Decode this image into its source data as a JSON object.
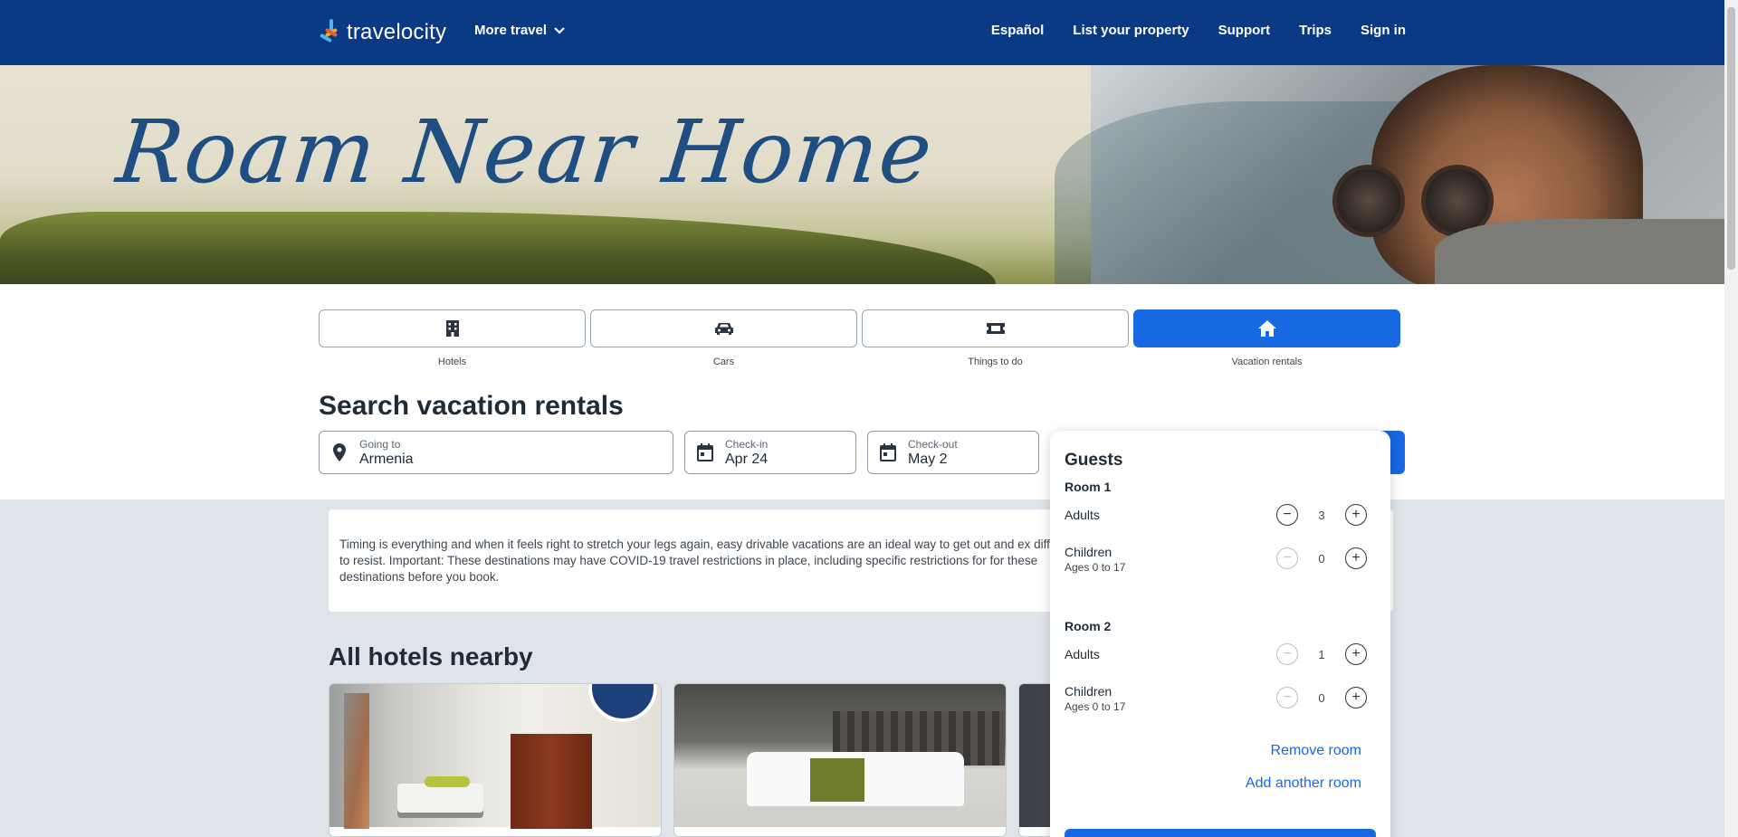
{
  "header": {
    "logo_text": "travelocity",
    "more_travel": "More travel",
    "nav": [
      "Español",
      "List your property",
      "Support",
      "Trips",
      "Sign in"
    ]
  },
  "hero": {
    "title": "Roam Near Home"
  },
  "lob_tabs": [
    {
      "label": "Hotels",
      "icon": "hotel-icon",
      "active": false
    },
    {
      "label": "Cars",
      "icon": "car-icon",
      "active": false
    },
    {
      "label": "Things to do",
      "icon": "ticket-icon",
      "active": false
    },
    {
      "label": "Vacation rentals",
      "icon": "house-icon",
      "active": true
    }
  ],
  "search": {
    "title": "Search vacation rentals",
    "going_to": {
      "label": "Going to",
      "value": "Armenia"
    },
    "check_in": {
      "label": "Check-in",
      "value": "Apr 24"
    },
    "check_out": {
      "label": "Check-out",
      "value": "May 2"
    }
  },
  "intro_text": "Timing is everything and when it feels right to stretch your legs again, easy drivable vacations are an ideal way to get out and ex difficult to resist. Important: These destinations may have COVID-19 travel restrictions in place, including specific restrictions for for these destinations before you book.",
  "section_title": "All hotels nearby",
  "guests": {
    "title": "Guests",
    "rooms": [
      {
        "title": "Room 1",
        "adults_label": "Adults",
        "adults": "3",
        "children_label": "Children",
        "children_sub": "Ages 0 to 17",
        "children": "0"
      },
      {
        "title": "Room 2",
        "adults_label": "Adults",
        "adults": "1",
        "children_label": "Children",
        "children_sub": "Ages 0 to 17",
        "children": "0"
      }
    ],
    "remove_room": "Remove room",
    "add_room": "Add another room"
  },
  "colors": {
    "brand": "#0b3a85",
    "accent": "#1668e3"
  }
}
